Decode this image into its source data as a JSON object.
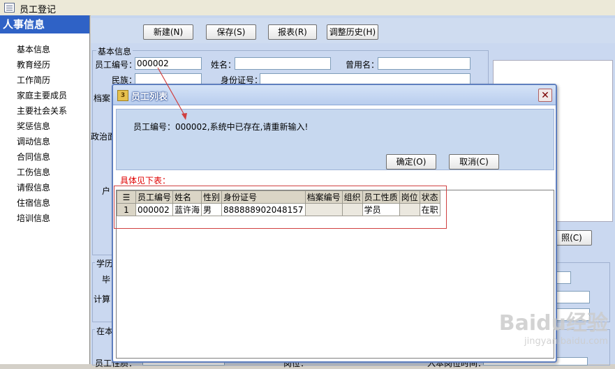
{
  "window": {
    "title": "员工登记"
  },
  "sidebar": {
    "header": "人事信息",
    "items": [
      "基本信息",
      "教育经历",
      "工作简历",
      "家庭主要成员",
      "主要社会关系",
      "奖惩信息",
      "调动信息",
      "合同信息",
      "工伤信息",
      "请假信息",
      "住宿信息",
      "培训信息"
    ]
  },
  "toolbar": {
    "new_label": "新建(N)",
    "save_label": "保存(S)",
    "report_label": "报表(R)",
    "history_label": "调整历史(H)"
  },
  "form": {
    "group_basic": "基本信息",
    "emp_id_label": "员工编号：",
    "emp_id_value": "000002",
    "name_label": "姓名：",
    "former_name_label": "曾用名：",
    "nation_label": "民族：",
    "id_card_label": "身份证号：",
    "archive_label": "档案",
    "political_label": "政治面",
    "household_label": "户",
    "photo_btn_label": "照(C)",
    "group_edu": "学历",
    "grad_label": "毕",
    "calc_label": "计算",
    "group_incumbent": "在本",
    "emp_type_label": "员工性质：",
    "position_label": "岗位：",
    "hire_date_label": "入本岗位时间："
  },
  "dialog": {
    "title": "员工列表",
    "message": "员工编号：000002,系统中已存在,请重新输入!",
    "ok_label": "确定(O)",
    "cancel_label": "取消(C)",
    "detail_label": "具体见下表：",
    "columns": [
      "员工编号",
      "姓名",
      "性别",
      "身份证号",
      "档案编号",
      "组织",
      "员工性质",
      "岗位",
      "状态"
    ],
    "rows": [
      {
        "row_no": "1",
        "cells": [
          "000002",
          "蓝许海",
          "男",
          "888888902048157",
          "",
          "",
          "学员",
          "",
          "在职"
        ]
      }
    ]
  },
  "watermark": {
    "brand": "Baidu经验",
    "url": "jingyan.baidu.com"
  },
  "colors": {
    "accent": "#2f62c6",
    "highlight": "#d04040"
  }
}
